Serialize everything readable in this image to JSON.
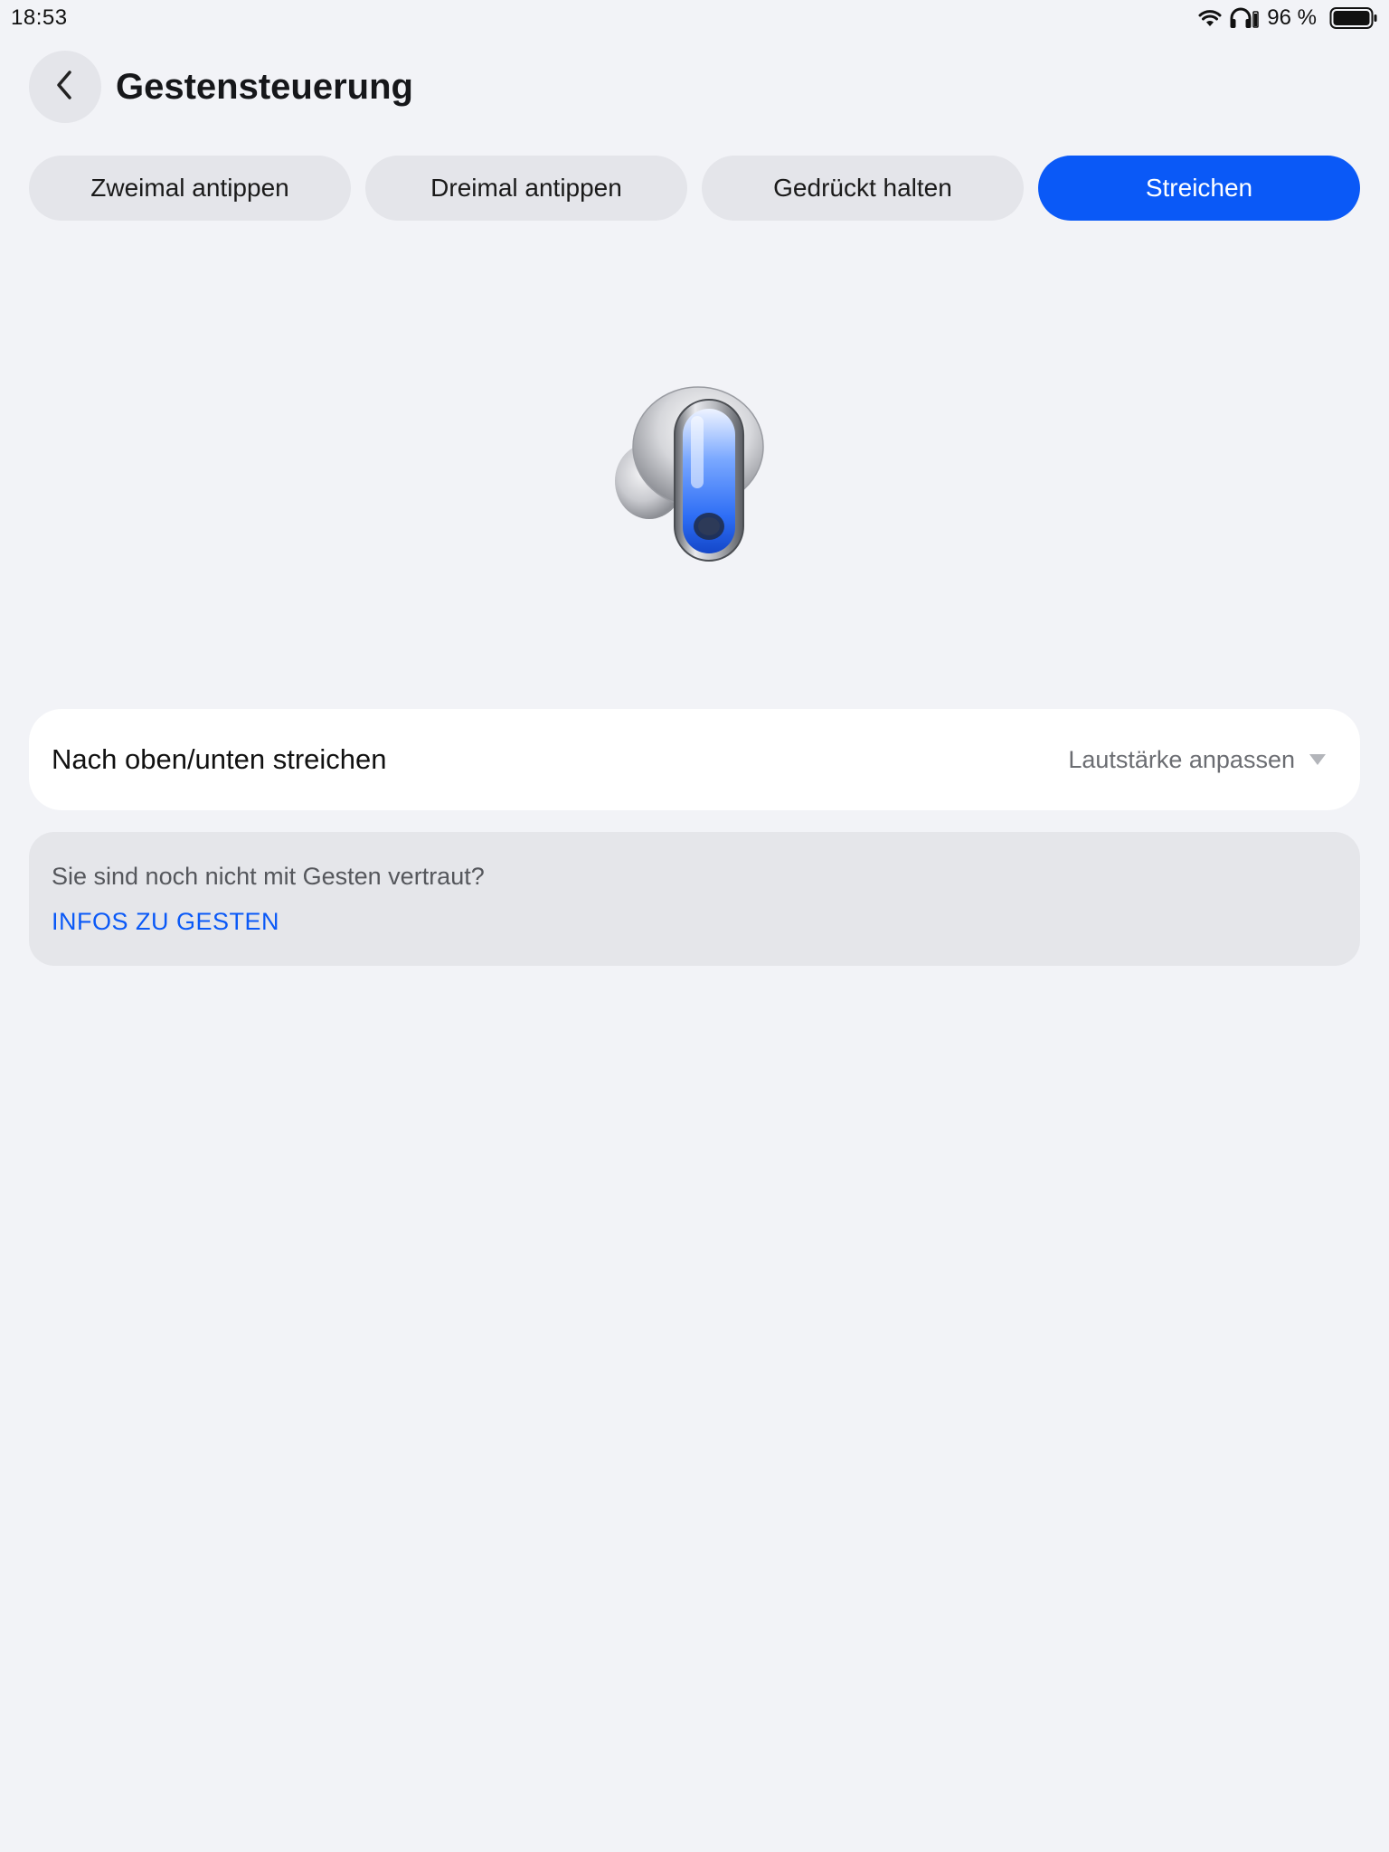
{
  "status_bar": {
    "time": "18:53",
    "battery_percent": "96 %",
    "icons": [
      "wifi-icon",
      "headphones-icon",
      "battery-icon"
    ]
  },
  "header": {
    "title": "Gestensteuerung",
    "back_icon": "chevron-left-icon"
  },
  "tabs": [
    {
      "label": "Zweimal antippen",
      "active": false
    },
    {
      "label": "Dreimal antippen",
      "active": false
    },
    {
      "label": "Gedrückt halten",
      "active": false
    },
    {
      "label": "Streichen",
      "active": true
    }
  ],
  "illustration": {
    "icon": "earbud-icon"
  },
  "setting": {
    "label": "Nach oben/unten streichen",
    "value": "Lautstärke anpassen",
    "icon": "dropdown-triangle-icon"
  },
  "info": {
    "text": "Sie sind noch nicht mit Gesten vertraut?",
    "link": "INFOS ZU GESTEN"
  },
  "colors": {
    "background": "#f2f3f7",
    "accent": "#0a59f7",
    "tab_inactive": "#e4e5ea",
    "card": "#ffffff",
    "info_card": "#e5e6ea"
  }
}
